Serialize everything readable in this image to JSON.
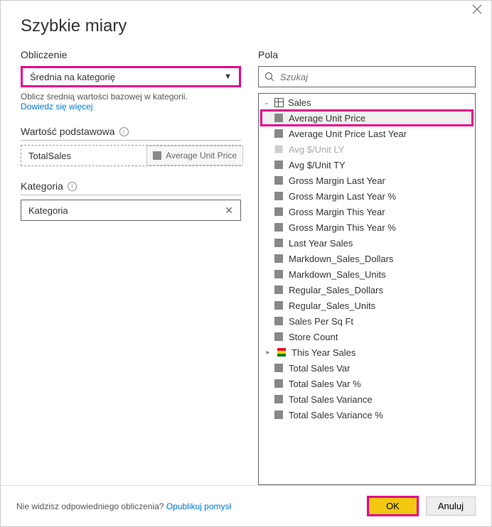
{
  "dialog": {
    "title": "Szybkie miary"
  },
  "left": {
    "calc_heading": "Obliczenie",
    "dropdown_value": "Średnia na kategorię",
    "hint": "Oblicz średnią wartości bazowej w kategorii.",
    "learn_more": "Dowiedz się więcej",
    "base_value_heading": "Wartość podstawowa",
    "base_value": "TotalSales",
    "drag_token": "Average Unit Price",
    "category_heading": "Kategoria",
    "category_value": "Kategoria"
  },
  "right": {
    "fields_heading": "Pola",
    "search_placeholder": "Szukaj",
    "table_name": "Sales",
    "fields": [
      {
        "label": "Average Unit Price",
        "type": "measure",
        "highlighted": true
      },
      {
        "label": "Average Unit Price Last Year",
        "type": "measure"
      },
      {
        "label": "Avg $/Unit LY",
        "type": "measure",
        "disabled": true
      },
      {
        "label": "Avg $/Unit TY",
        "type": "measure"
      },
      {
        "label": "Gross Margin Last Year",
        "type": "measure"
      },
      {
        "label": "Gross Margin Last Year %",
        "type": "measure"
      },
      {
        "label": "Gross Margin This Year",
        "type": "measure"
      },
      {
        "label": "Gross Margin This Year %",
        "type": "measure"
      },
      {
        "label": "Last Year Sales",
        "type": "measure"
      },
      {
        "label": "Markdown_Sales_Dollars",
        "type": "measure"
      },
      {
        "label": "Markdown_Sales_Units",
        "type": "measure"
      },
      {
        "label": "Regular_Sales_Dollars",
        "type": "measure"
      },
      {
        "label": "Regular_Sales_Units",
        "type": "measure"
      },
      {
        "label": "Sales Per Sq Ft",
        "type": "measure"
      },
      {
        "label": "Store Count",
        "type": "measure"
      },
      {
        "label": "This Year Sales",
        "type": "kpi",
        "expandable": true
      },
      {
        "label": "Total Sales Var",
        "type": "measure"
      },
      {
        "label": "Total Sales Var %",
        "type": "measure"
      },
      {
        "label": "Total Sales Variance",
        "type": "measure"
      },
      {
        "label": "Total Sales Variance %",
        "type": "measure"
      }
    ]
  },
  "footer": {
    "hint": "Nie widzisz odpowiedniego obliczenia?",
    "link": "Opublikuj pomysł",
    "ok": "OK",
    "cancel": "Anuluj"
  }
}
